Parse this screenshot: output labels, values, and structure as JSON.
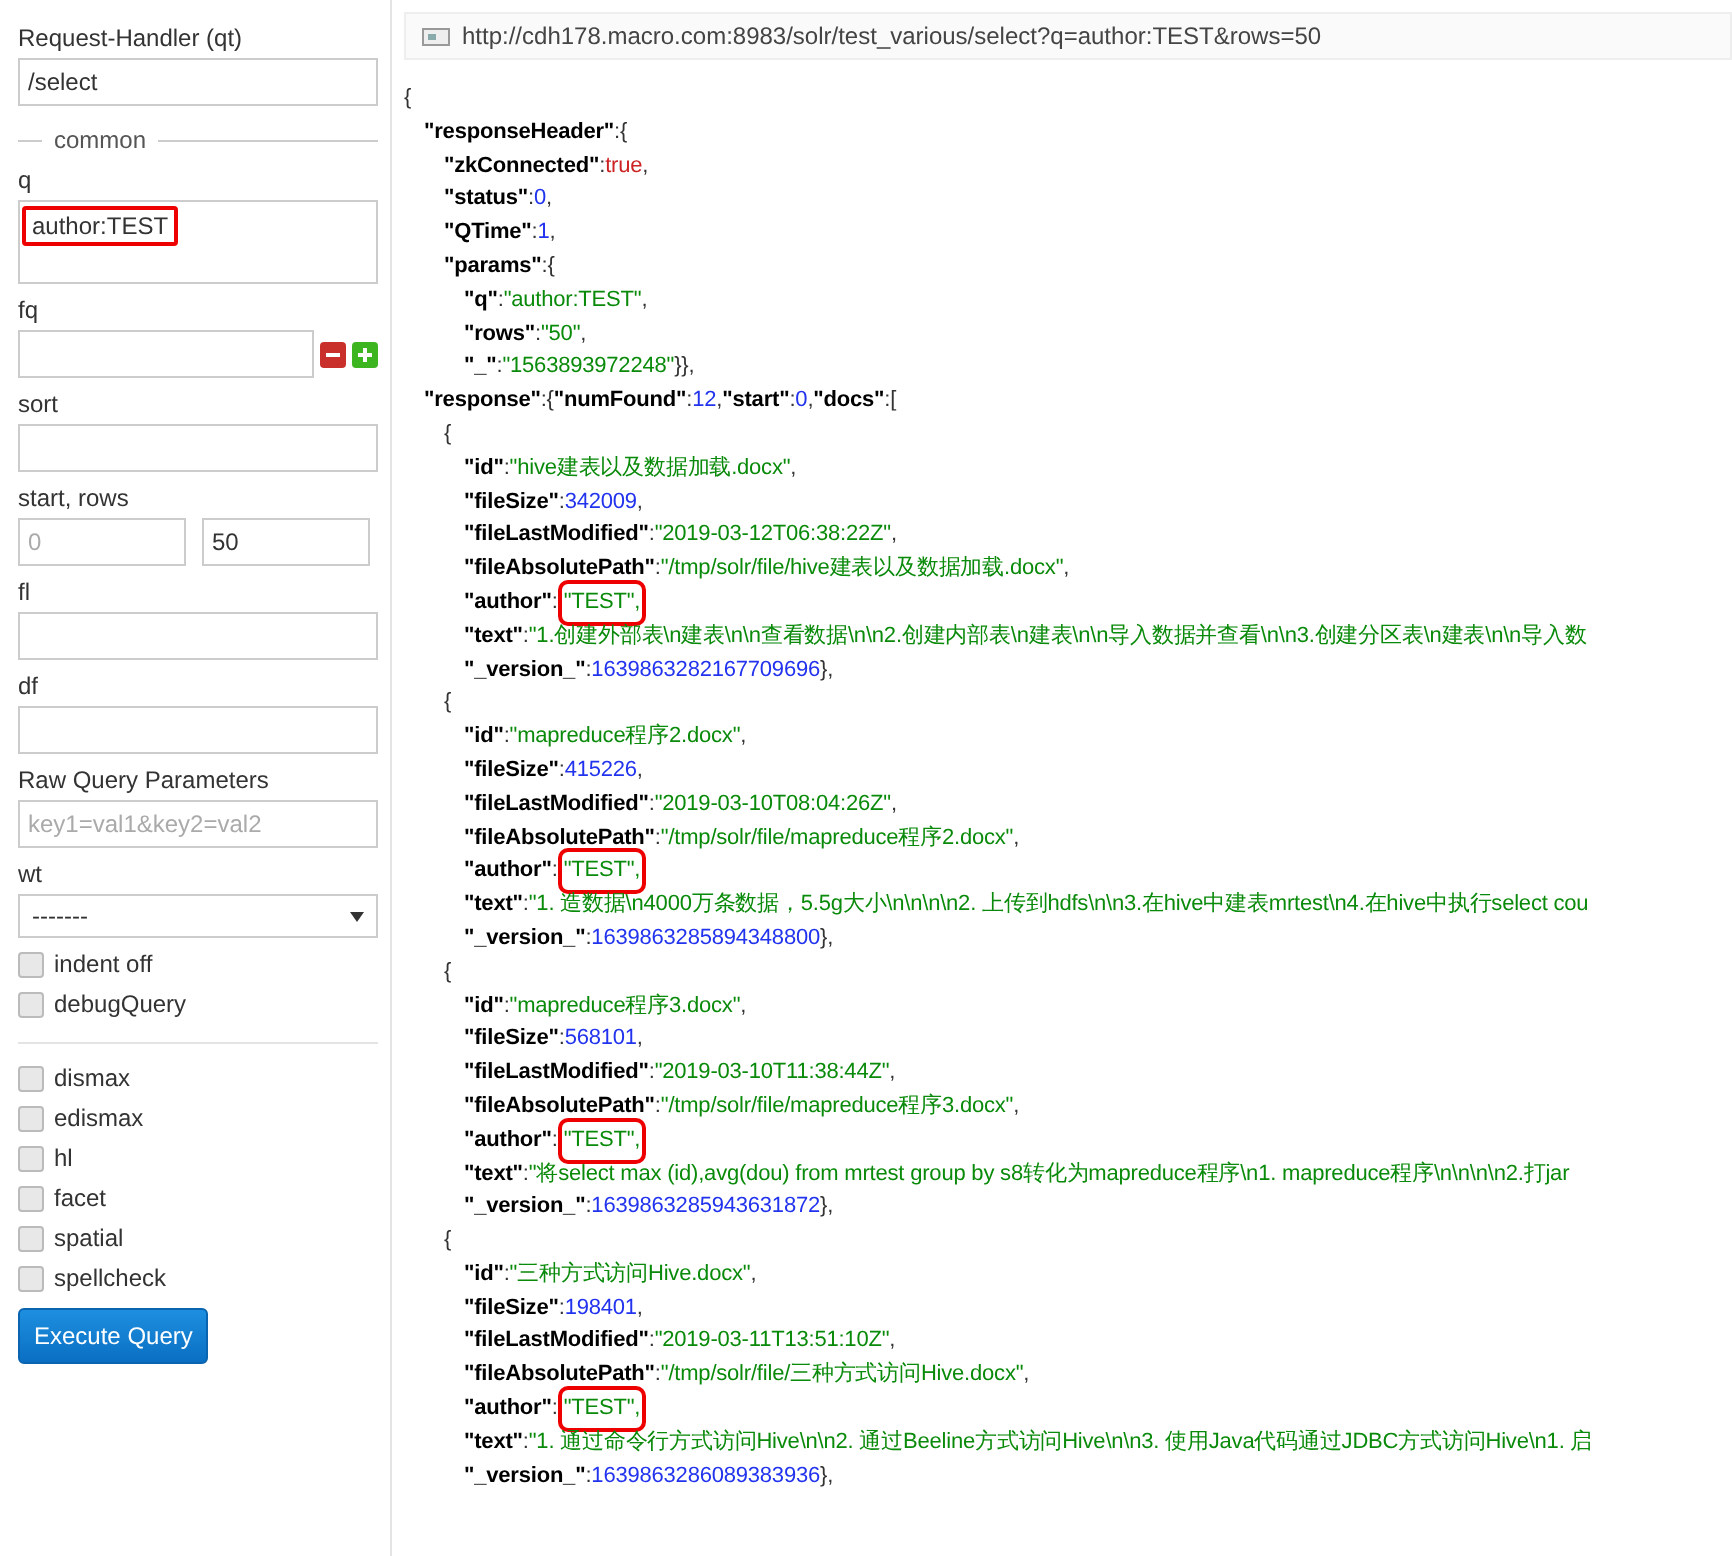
{
  "sidebar": {
    "request_handler": {
      "label": "Request-Handler (qt)",
      "value": "/select"
    },
    "legend": "common",
    "fields": [
      {
        "kind": "textarea",
        "label": "q",
        "value": "author:TEST",
        "highlighted": true
      },
      {
        "kind": "multi",
        "label": "fq"
      },
      {
        "kind": "text",
        "label": "sort"
      },
      {
        "kind": "pair",
        "label": "start, rows",
        "placeholder": "0",
        "value": "50"
      },
      {
        "kind": "text",
        "label": "fl"
      },
      {
        "kind": "text",
        "label": "df"
      },
      {
        "kind": "text",
        "label": "Raw Query Parameters",
        "placeholder": "key1=val1&key2=val2"
      },
      {
        "kind": "select",
        "label": "wt",
        "value": "-------"
      }
    ],
    "options": [
      {
        "label": "indent off",
        "checked": false
      },
      {
        "label": "debugQuery",
        "checked": false
      }
    ],
    "parsers": [
      {
        "label": "dismax",
        "checked": false
      },
      {
        "label": "edismax",
        "checked": false
      },
      {
        "label": "hl",
        "checked": false
      },
      {
        "label": "facet",
        "checked": false
      },
      {
        "label": "spatial",
        "checked": false
      },
      {
        "label": "spellcheck",
        "checked": false
      }
    ],
    "execute_button": "Execute Query"
  },
  "result": {
    "url": "http://cdh178.macro.com:8983/solr/test_various/select?q=author:TEST&rows=50",
    "lines": [
      {
        "tokens": [
          {
            "text": "{",
            "kind": "p"
          }
        ],
        "children": [
          {
            "tokens": [
              {
                "text": "\"responseHeader\"",
                "kind": "key"
              },
              {
                "text": ":{",
                "kind": "p"
              }
            ],
            "children": [
              {
                "tokens": [
                  {
                    "text": "\"zkConnected\"",
                    "kind": "key"
                  },
                  {
                    "text": ":",
                    "kind": "p"
                  },
                  {
                    "text": "true",
                    "kind": "bool"
                  },
                  {
                    "text": ",",
                    "kind": "p"
                  }
                ]
              },
              {
                "tokens": [
                  {
                    "text": "\"status\"",
                    "kind": "key"
                  },
                  {
                    "text": ":",
                    "kind": "p"
                  },
                  {
                    "text": "0",
                    "kind": "num"
                  },
                  {
                    "text": ",",
                    "kind": "p"
                  }
                ]
              },
              {
                "tokens": [
                  {
                    "text": "\"QTime\"",
                    "kind": "key"
                  },
                  {
                    "text": ":",
                    "kind": "p"
                  },
                  {
                    "text": "1",
                    "kind": "num"
                  },
                  {
                    "text": ",",
                    "kind": "p"
                  }
                ]
              },
              {
                "tokens": [
                  {
                    "text": "\"params\"",
                    "kind": "key"
                  },
                  {
                    "text": ":{",
                    "kind": "p"
                  }
                ],
                "children": [
                  {
                    "tokens": [
                      {
                        "text": "\"q\"",
                        "kind": "key"
                      },
                      {
                        "text": ":",
                        "kind": "p"
                      },
                      {
                        "text": "\"author:TEST\"",
                        "kind": "str"
                      },
                      {
                        "text": ",",
                        "kind": "p"
                      }
                    ]
                  },
                  {
                    "tokens": [
                      {
                        "text": "\"rows\"",
                        "kind": "key"
                      },
                      {
                        "text": ":",
                        "kind": "p"
                      },
                      {
                        "text": "\"50\"",
                        "kind": "str"
                      },
                      {
                        "text": ",",
                        "kind": "p"
                      }
                    ]
                  },
                  {
                    "tokens": [
                      {
                        "text": "\"_\"",
                        "kind": "key"
                      },
                      {
                        "text": ":",
                        "kind": "p"
                      },
                      {
                        "text": "\"1563893972248\"",
                        "kind": "str"
                      },
                      {
                        "text": "}},",
                        "kind": "p"
                      }
                    ]
                  }
                ]
              }
            ]
          },
          {
            "tokens": [
              {
                "text": "\"response\"",
                "kind": "key"
              },
              {
                "text": ":{",
                "kind": "p"
              },
              {
                "text": "\"numFound\"",
                "kind": "key"
              },
              {
                "text": ":",
                "kind": "p"
              },
              {
                "text": "12",
                "kind": "num"
              },
              {
                "text": ",",
                "kind": "p"
              },
              {
                "text": "\"start\"",
                "kind": "key"
              },
              {
                "text": ":",
                "kind": "p"
              },
              {
                "text": "0",
                "kind": "num"
              },
              {
                "text": ",",
                "kind": "p"
              },
              {
                "text": "\"docs\"",
                "kind": "key"
              },
              {
                "text": ":[",
                "kind": "p"
              }
            ],
            "children": [
              {
                "tokens": [
                  {
                    "text": "{",
                    "kind": "p"
                  }
                ],
                "children": [
                  {
                    "tokens": [
                      {
                        "text": "\"id\"",
                        "kind": "key"
                      },
                      {
                        "text": ":",
                        "kind": "p"
                      },
                      {
                        "text": "\"hive建表以及数据加载.docx\"",
                        "kind": "str"
                      },
                      {
                        "text": ",",
                        "kind": "p"
                      }
                    ]
                  },
                  {
                    "tokens": [
                      {
                        "text": "\"fileSize\"",
                        "kind": "key"
                      },
                      {
                        "text": ":",
                        "kind": "p"
                      },
                      {
                        "text": "342009",
                        "kind": "num"
                      },
                      {
                        "text": ",",
                        "kind": "p"
                      }
                    ]
                  },
                  {
                    "tokens": [
                      {
                        "text": "\"fileLastModified\"",
                        "kind": "key"
                      },
                      {
                        "text": ":",
                        "kind": "p"
                      },
                      {
                        "text": "\"2019-03-12T06:38:22Z\"",
                        "kind": "str"
                      },
                      {
                        "text": ",",
                        "kind": "p"
                      }
                    ]
                  },
                  {
                    "tokens": [
                      {
                        "text": "\"fileAbsolutePath\"",
                        "kind": "key"
                      },
                      {
                        "text": ":",
                        "kind": "p"
                      },
                      {
                        "text": "\"/tmp/solr/file/hive建表以及数据加载.docx\"",
                        "kind": "str"
                      },
                      {
                        "text": ",",
                        "kind": "p"
                      }
                    ]
                  },
                  {
                    "tokens": [
                      {
                        "text": "\"author\"",
                        "kind": "key"
                      },
                      {
                        "text": ":",
                        "kind": "p"
                      },
                      {
                        "text": "\"TEST\",",
                        "kind": "str",
                        "highlighted": true
                      }
                    ]
                  },
                  {
                    "tokens": [
                      {
                        "text": "\"text\"",
                        "kind": "key"
                      },
                      {
                        "text": ":",
                        "kind": "p"
                      },
                      {
                        "text": "\"1.创建外部表\\n建表\\n\\n查看数据\\n\\n2.创建内部表\\n建表\\n\\n导入数据并查看\\n\\n3.创建分区表\\n建表\\n\\n导入数",
                        "kind": "str"
                      }
                    ]
                  },
                  {
                    "tokens": [
                      {
                        "text": "\"_version_\"",
                        "kind": "key"
                      },
                      {
                        "text": ":",
                        "kind": "p"
                      },
                      {
                        "text": "1639863282167709696",
                        "kind": "num"
                      },
                      {
                        "text": "},",
                        "kind": "p"
                      }
                    ]
                  }
                ]
              },
              {
                "tokens": [
                  {
                    "text": "{",
                    "kind": "p"
                  }
                ],
                "children": [
                  {
                    "tokens": [
                      {
                        "text": "\"id\"",
                        "kind": "key"
                      },
                      {
                        "text": ":",
                        "kind": "p"
                      },
                      {
                        "text": "\"mapreduce程序2.docx\"",
                        "kind": "str"
                      },
                      {
                        "text": ",",
                        "kind": "p"
                      }
                    ]
                  },
                  {
                    "tokens": [
                      {
                        "text": "\"fileSize\"",
                        "kind": "key"
                      },
                      {
                        "text": ":",
                        "kind": "p"
                      },
                      {
                        "text": "415226",
                        "kind": "num"
                      },
                      {
                        "text": ",",
                        "kind": "p"
                      }
                    ]
                  },
                  {
                    "tokens": [
                      {
                        "text": "\"fileLastModified\"",
                        "kind": "key"
                      },
                      {
                        "text": ":",
                        "kind": "p"
                      },
                      {
                        "text": "\"2019-03-10T08:04:26Z\"",
                        "kind": "str"
                      },
                      {
                        "text": ",",
                        "kind": "p"
                      }
                    ]
                  },
                  {
                    "tokens": [
                      {
                        "text": "\"fileAbsolutePath\"",
                        "kind": "key"
                      },
                      {
                        "text": ":",
                        "kind": "p"
                      },
                      {
                        "text": "\"/tmp/solr/file/mapreduce程序2.docx\"",
                        "kind": "str"
                      },
                      {
                        "text": ",",
                        "kind": "p"
                      }
                    ]
                  },
                  {
                    "tokens": [
                      {
                        "text": "\"author\"",
                        "kind": "key"
                      },
                      {
                        "text": ":",
                        "kind": "p"
                      },
                      {
                        "text": "\"TEST\",",
                        "kind": "str",
                        "highlighted": true
                      }
                    ]
                  },
                  {
                    "tokens": [
                      {
                        "text": "\"text\"",
                        "kind": "key"
                      },
                      {
                        "text": ":",
                        "kind": "p"
                      },
                      {
                        "text": "\"1. 造数据\\n4000万条数据，5.5g大小\\n\\n\\n\\n2. 上传到hdfs\\n\\n3.在hive中建表mrtest\\n4.在hive中执行select cou",
                        "kind": "str"
                      }
                    ]
                  },
                  {
                    "tokens": [
                      {
                        "text": "\"_version_\"",
                        "kind": "key"
                      },
                      {
                        "text": ":",
                        "kind": "p"
                      },
                      {
                        "text": "1639863285894348800",
                        "kind": "num"
                      },
                      {
                        "text": "},",
                        "kind": "p"
                      }
                    ]
                  }
                ]
              },
              {
                "tokens": [
                  {
                    "text": "{",
                    "kind": "p"
                  }
                ],
                "children": [
                  {
                    "tokens": [
                      {
                        "text": "\"id\"",
                        "kind": "key"
                      },
                      {
                        "text": ":",
                        "kind": "p"
                      },
                      {
                        "text": "\"mapreduce程序3.docx\"",
                        "kind": "str"
                      },
                      {
                        "text": ",",
                        "kind": "p"
                      }
                    ]
                  },
                  {
                    "tokens": [
                      {
                        "text": "\"fileSize\"",
                        "kind": "key"
                      },
                      {
                        "text": ":",
                        "kind": "p"
                      },
                      {
                        "text": "568101",
                        "kind": "num"
                      },
                      {
                        "text": ",",
                        "kind": "p"
                      }
                    ]
                  },
                  {
                    "tokens": [
                      {
                        "text": "\"fileLastModified\"",
                        "kind": "key"
                      },
                      {
                        "text": ":",
                        "kind": "p"
                      },
                      {
                        "text": "\"2019-03-10T11:38:44Z\"",
                        "kind": "str"
                      },
                      {
                        "text": ",",
                        "kind": "p"
                      }
                    ]
                  },
                  {
                    "tokens": [
                      {
                        "text": "\"fileAbsolutePath\"",
                        "kind": "key"
                      },
                      {
                        "text": ":",
                        "kind": "p"
                      },
                      {
                        "text": "\"/tmp/solr/file/mapreduce程序3.docx\"",
                        "kind": "str"
                      },
                      {
                        "text": ",",
                        "kind": "p"
                      }
                    ]
                  },
                  {
                    "tokens": [
                      {
                        "text": "\"author\"",
                        "kind": "key"
                      },
                      {
                        "text": ":",
                        "kind": "p"
                      },
                      {
                        "text": "\"TEST\",",
                        "kind": "str",
                        "highlighted": true
                      }
                    ]
                  },
                  {
                    "tokens": [
                      {
                        "text": "\"text\"",
                        "kind": "key"
                      },
                      {
                        "text": ":",
                        "kind": "p"
                      },
                      {
                        "text": "\"将select max (id),avg(dou) from mrtest group by s8转化为mapreduce程序\\n1. mapreduce程序\\n\\n\\n\\n2.打jar",
                        "kind": "str"
                      }
                    ]
                  },
                  {
                    "tokens": [
                      {
                        "text": "\"_version_\"",
                        "kind": "key"
                      },
                      {
                        "text": ":",
                        "kind": "p"
                      },
                      {
                        "text": "1639863285943631872",
                        "kind": "num"
                      },
                      {
                        "text": "},",
                        "kind": "p"
                      }
                    ]
                  }
                ]
              },
              {
                "tokens": [
                  {
                    "text": "{",
                    "kind": "p"
                  }
                ],
                "children": [
                  {
                    "tokens": [
                      {
                        "text": "\"id\"",
                        "kind": "key"
                      },
                      {
                        "text": ":",
                        "kind": "p"
                      },
                      {
                        "text": "\"三种方式访问Hive.docx\"",
                        "kind": "str"
                      },
                      {
                        "text": ",",
                        "kind": "p"
                      }
                    ]
                  },
                  {
                    "tokens": [
                      {
                        "text": "\"fileSize\"",
                        "kind": "key"
                      },
                      {
                        "text": ":",
                        "kind": "p"
                      },
                      {
                        "text": "198401",
                        "kind": "num"
                      },
                      {
                        "text": ",",
                        "kind": "p"
                      }
                    ]
                  },
                  {
                    "tokens": [
                      {
                        "text": "\"fileLastModified\"",
                        "kind": "key"
                      },
                      {
                        "text": ":",
                        "kind": "p"
                      },
                      {
                        "text": "\"2019-03-11T13:51:10Z\"",
                        "kind": "str"
                      },
                      {
                        "text": ",",
                        "kind": "p"
                      }
                    ]
                  },
                  {
                    "tokens": [
                      {
                        "text": "\"fileAbsolutePath\"",
                        "kind": "key"
                      },
                      {
                        "text": ":",
                        "kind": "p"
                      },
                      {
                        "text": "\"/tmp/solr/file/三种方式访问Hive.docx\"",
                        "kind": "str"
                      },
                      {
                        "text": ",",
                        "kind": "p"
                      }
                    ]
                  },
                  {
                    "tokens": [
                      {
                        "text": "\"author\"",
                        "kind": "key"
                      },
                      {
                        "text": ":",
                        "kind": "p"
                      },
                      {
                        "text": "\"TEST\",",
                        "kind": "str",
                        "highlighted": true
                      }
                    ]
                  },
                  {
                    "tokens": [
                      {
                        "text": "\"text\"",
                        "kind": "key"
                      },
                      {
                        "text": ":",
                        "kind": "p"
                      },
                      {
                        "text": "\"1. 通过命令行方式访问Hive\\n\\n2. 通过Beeline方式访问Hive\\n\\n3. 使用Java代码通过JDBC方式访问Hive\\n1. 启",
                        "kind": "str"
                      }
                    ]
                  },
                  {
                    "tokens": [
                      {
                        "text": "\"_version_\"",
                        "kind": "key"
                      },
                      {
                        "text": ":",
                        "kind": "p"
                      },
                      {
                        "text": "1639863286089383936",
                        "kind": "num"
                      },
                      {
                        "text": "},",
                        "kind": "p"
                      }
                    ]
                  }
                ]
              }
            ]
          }
        ]
      }
    ]
  }
}
